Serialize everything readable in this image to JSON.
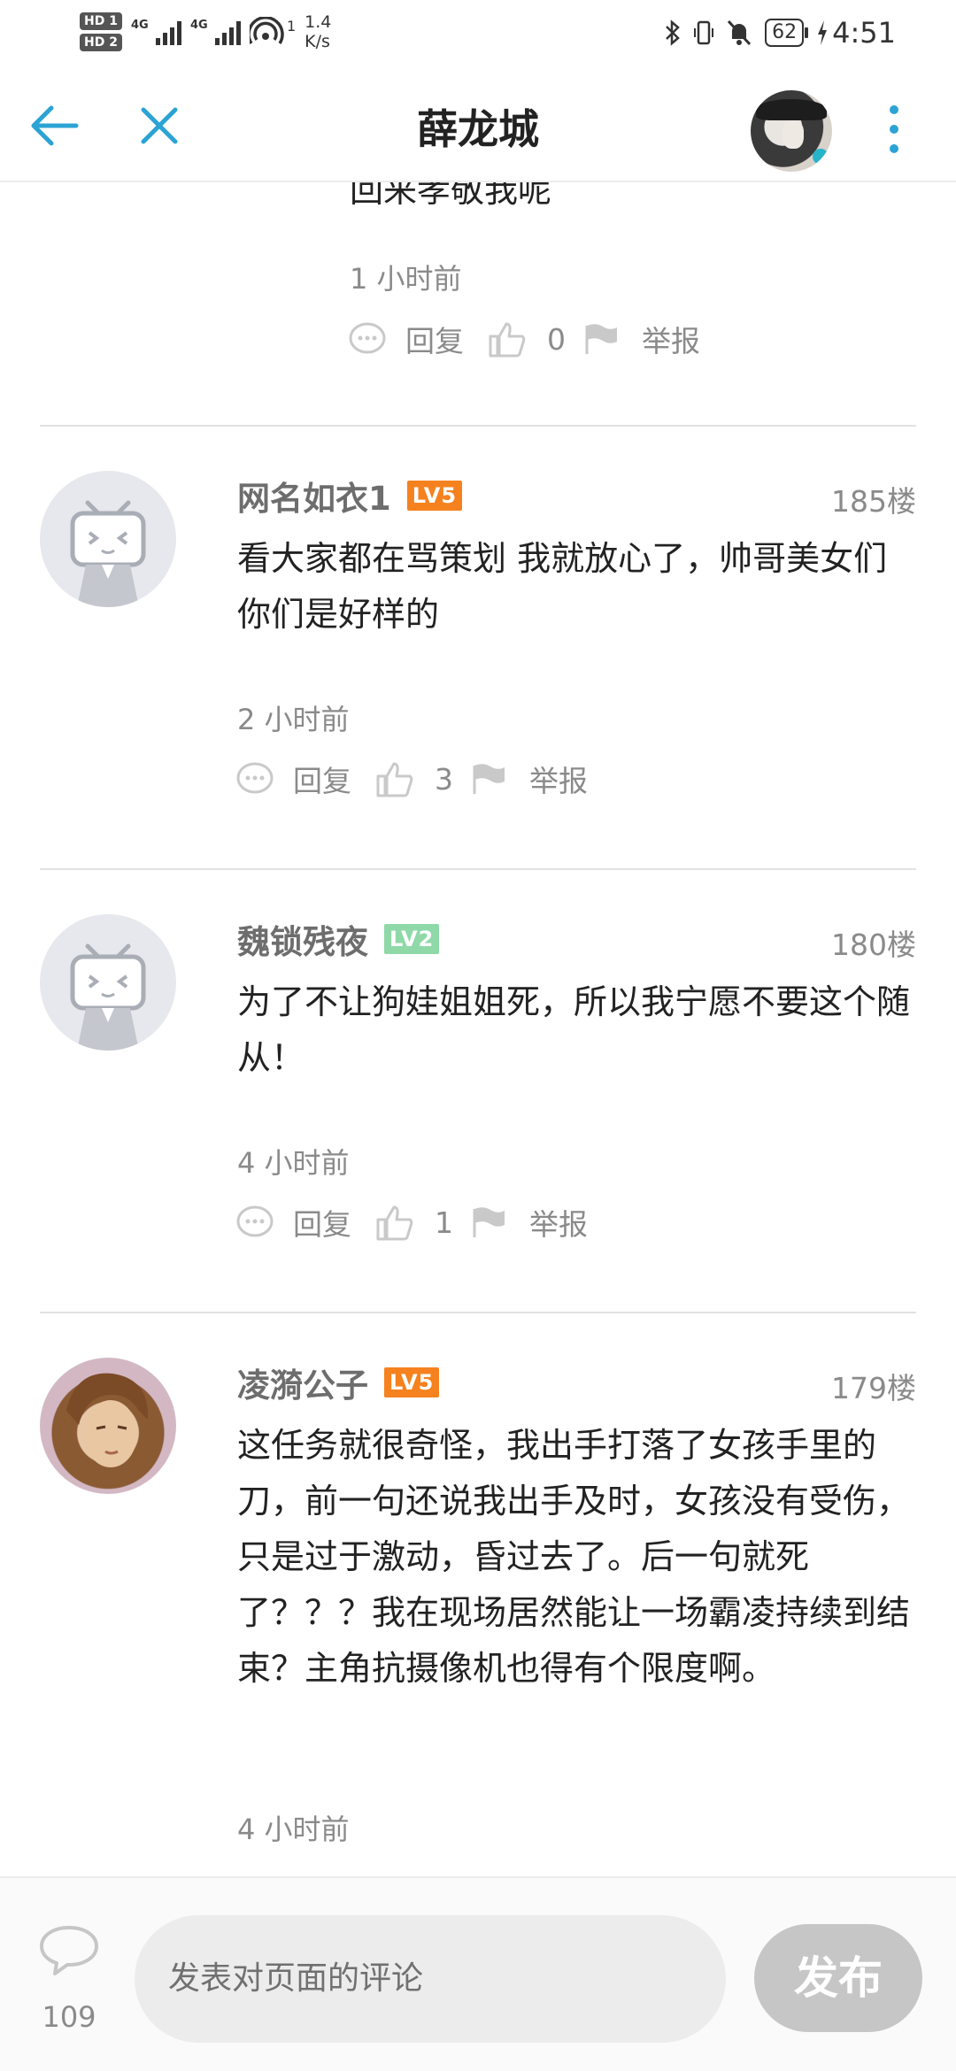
{
  "status_bar": {
    "sim1": "HD 1",
    "sim2": "HD 2",
    "net1": "4G",
    "net2": "4G",
    "hotspot_count": "1",
    "speed_value": "1.4",
    "speed_unit": "K/s",
    "battery": "62",
    "time": "4:51"
  },
  "header": {
    "title": "薛龙城",
    "back_icon": "back-arrow-icon",
    "close_icon": "close-icon",
    "more_icon": "more-vertical-icon"
  },
  "partial_comment": {
    "text": "回来孝敬我呢",
    "time": "1 小时前",
    "reply_label": "回复",
    "likes": "0",
    "report_label": "举报"
  },
  "comments": [
    {
      "username": "网名如衣1",
      "level": "LV5",
      "level_color": "#f5821f",
      "floor": "185楼",
      "text": "看大家都在骂策划 我就放心了，帅哥美女们 你们是好样的",
      "time": "2 小时前",
      "reply_label": "回复",
      "likes": "3",
      "report_label": "举报"
    },
    {
      "username": "魏锁残夜",
      "level": "LV2",
      "level_color": "#8fd9a8",
      "floor": "180楼",
      "text": "为了不让狗娃姐姐死，所以我宁愿不要这个随从！",
      "time": "4 小时前",
      "reply_label": "回复",
      "likes": "1",
      "report_label": "举报"
    },
    {
      "username": "凌漪公子",
      "level": "LV5",
      "level_color": "#f5821f",
      "floor": "179楼",
      "text": "这任务就很奇怪，我出手打落了女孩手里的刀，前一句还说我出手及时，女孩没有受伤，只是过于激动，昏过去了。后一句就死了？？？我在现场居然能让一场霸凌持续到结束？主角抗摄像机也得有个限度啊。",
      "time": "4 小时前"
    }
  ],
  "bottom_bar": {
    "comment_count": "109",
    "input_placeholder": "发表对页面的评论",
    "send_label": "发布"
  },
  "colors": {
    "accent": "#2ba3d4",
    "muted_text": "#8a8a8a",
    "level_orange": "#f5821f",
    "level_green": "#8fd9a8"
  }
}
